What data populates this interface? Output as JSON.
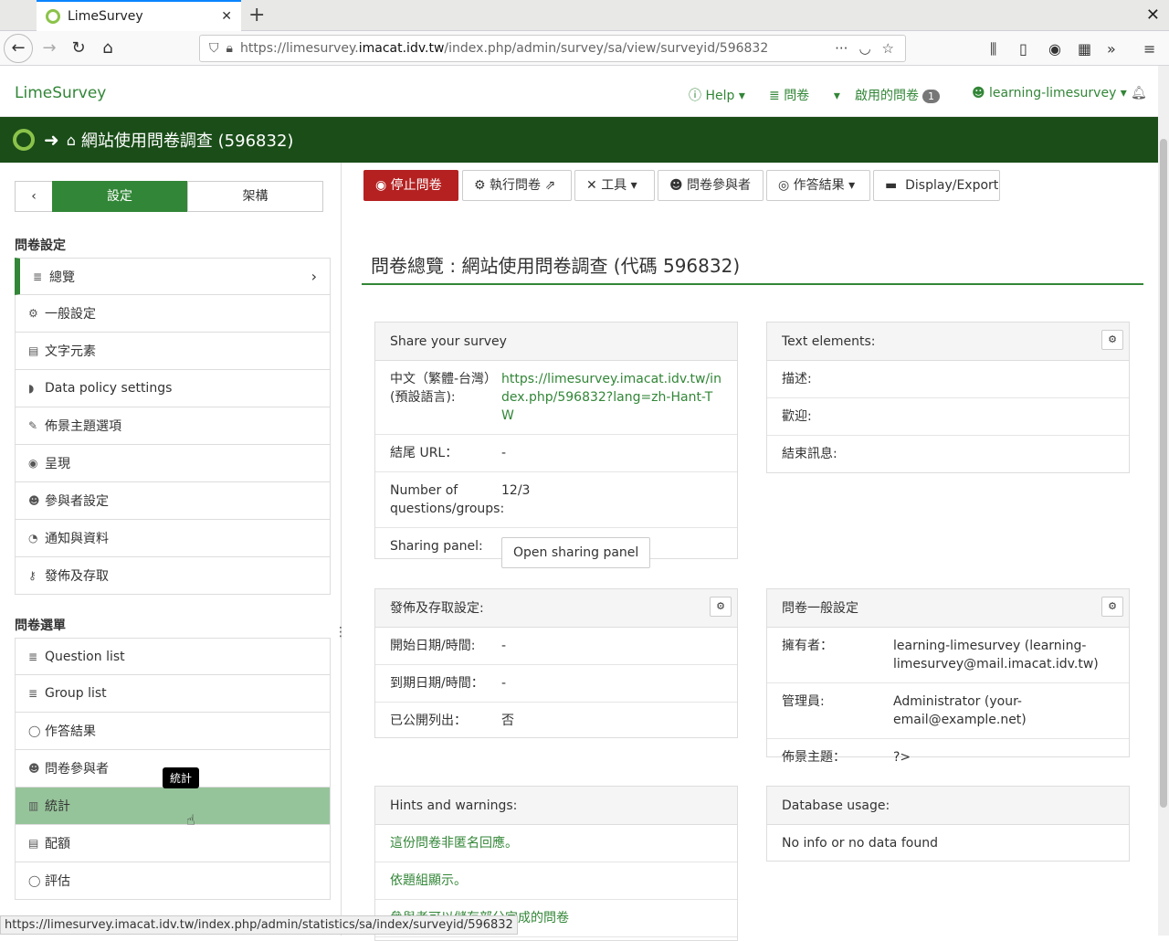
{
  "browser": {
    "tab_title": "LimeSurvey",
    "url_prefix": "https://limesurvey.",
    "url_domain": "imacat.idv.tw",
    "url_path": "/index.php/admin/survey/sa/view/surveyid/596832",
    "status_url": "https://limesurvey.imacat.idv.tw/index.php/admin/statistics/sa/index/surveyid/596832"
  },
  "app": {
    "brand": "LimeSurvey",
    "nav_help": "Help",
    "nav_surveys": "問卷",
    "nav_active": "啟用的問卷",
    "nav_active_count": "1",
    "nav_user": "learning-limesurvey",
    "survey_title": "網站使用問卷調查",
    "survey_id": "(596832)"
  },
  "sidebar": {
    "btn_settings": "設定",
    "btn_structure": "架構",
    "section_settings": "問卷設定",
    "settings_items": [
      {
        "icon": "≣",
        "label": "總覽"
      },
      {
        "icon": "⚙",
        "label": "一般設定"
      },
      {
        "icon": "▤",
        "label": "文字元素"
      },
      {
        "icon": "◗",
        "label": "Data policy settings"
      },
      {
        "icon": "✎",
        "label": "佈景主題選項"
      },
      {
        "icon": "◉",
        "label": "呈現"
      },
      {
        "icon": "☻",
        "label": "參與者設定"
      },
      {
        "icon": "◔",
        "label": "通知與資料"
      },
      {
        "icon": "⚷",
        "label": "發佈及存取"
      }
    ],
    "section_menu": "問卷選單",
    "menu_items": [
      {
        "icon": "≣",
        "label": "Question list"
      },
      {
        "icon": "≣",
        "label": "Group list"
      },
      {
        "icon": "◯",
        "label": "作答結果"
      },
      {
        "icon": "☻",
        "label": "問卷參與者"
      },
      {
        "icon": "▥",
        "label": "統計"
      },
      {
        "icon": "▤",
        "label": "配額"
      },
      {
        "icon": "◯",
        "label": "評估"
      }
    ],
    "tooltip": "統計"
  },
  "toolbar": {
    "stop": "停止問卷",
    "run": "執行問卷",
    "tools": "工具",
    "participants": "問卷參與者",
    "responses": "作答結果",
    "display_export": "Display/Export"
  },
  "main": {
    "page_title": "問卷總覽 : 網站使用問卷調查 (代碼 596832)",
    "share": {
      "header": "Share your survey",
      "lang_label": "中文（繁體-台灣）(預設語言):",
      "lang_link": "https://limesurvey.imacat.idv.tw/index.php/596832?lang=zh-Hant-TW",
      "end_url_label": "結尾 URL：",
      "end_url_value": "-",
      "num_label": "Number of questions/groups:",
      "num_value": "12/3",
      "sharing_label": "Sharing panel:",
      "sharing_button": "Open sharing panel"
    },
    "text_elements": {
      "header": "Text elements:",
      "rows": [
        "描述:",
        "歡迎:",
        "結束訊息:"
      ]
    },
    "publish": {
      "header": "發佈及存取設定:",
      "rows": [
        {
          "k": "開始日期/時間:",
          "v": "-"
        },
        {
          "k": "到期日期/時間：",
          "v": "-"
        },
        {
          "k": "已公開列出：",
          "v": "否"
        }
      ]
    },
    "general": {
      "header": "問卷一般設定",
      "rows": [
        {
          "k": "擁有者：",
          "v": "learning-limesurvey (learning-limesurvey@mail.imacat.idv.tw)"
        },
        {
          "k": "管理員:",
          "v": "Administrator (your-email@example.net)"
        },
        {
          "k": "佈景主題：",
          "v": "?>"
        }
      ]
    },
    "hints": {
      "header": "Hints and warnings:",
      "items": [
        "這份問卷非匿名回應。",
        "依題組顯示。",
        "參與者可以儲存部分完成的問卷"
      ]
    },
    "db": {
      "header": "Database usage:",
      "text": "No info or no data found"
    }
  }
}
